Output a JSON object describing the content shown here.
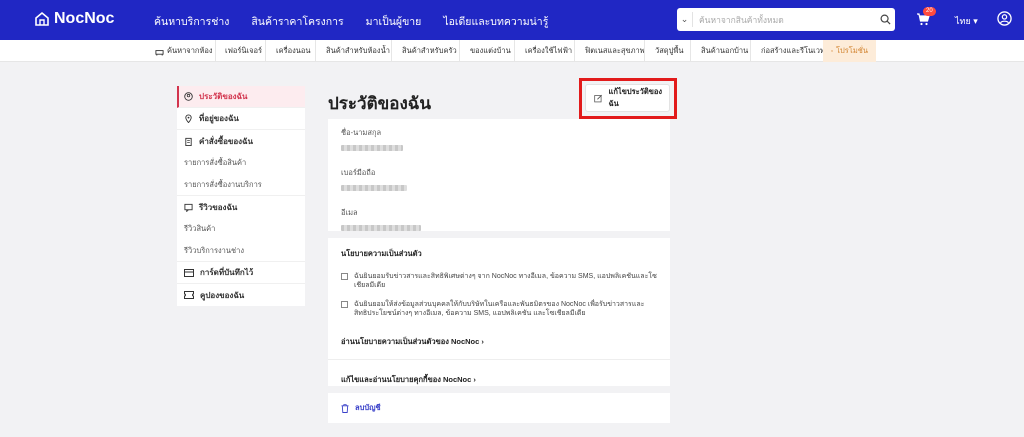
{
  "header": {
    "logo": "NocNoc",
    "nav": [
      "ค้นหาบริการช่าง",
      "สินค้าราคาโครงการ",
      "มาเป็นผู้ขาย",
      "ไอเดียและบทความน่ารู้"
    ],
    "search_placeholder": "ค้นหาจากสินค้าทั้งหมด",
    "cart_count": "20",
    "lang": "ไทย ▾"
  },
  "categories": [
    "ค้นหาจากห้อง",
    "เฟอร์นิเจอร์",
    "เครื่องนอน",
    "สินค้าสำหรับห้องน้ำ",
    "สินค้าสำหรับครัว",
    "ของแต่งบ้าน",
    "เครื่องใช้ไฟฟ้า",
    "ฟิตเนสและสุขภาพ",
    "วัสดุปูพื้น",
    "สินค้านอกบ้าน",
    "ก่อสร้างและรีโนเวท",
    "โปรโมชั่น"
  ],
  "sidebar": {
    "profile": "ประวัติของฉัน",
    "address": "ที่อยู่ของฉัน",
    "orders": "คำสั่งซื้อของฉัน",
    "order_products": "รายการสั่งซื้อสินค้า",
    "order_services": "รายการสั่งซื้องานบริการ",
    "reviews": "รีวิวของฉัน",
    "review_products": "รีวิวสินค้า",
    "review_services": "รีวิวบริการงานช่าง",
    "cards": "การ์ดที่บันทึกไว้",
    "coupons": "คูปองของฉัน"
  },
  "main": {
    "title": "ประวัติของฉัน",
    "edit_button": "แก้ไขประวัติของฉัน",
    "fields": {
      "name_label": "ชื่อ-นามสกุล",
      "phone_label": "เบอร์มือถือ",
      "email_label": "อีเมล"
    },
    "privacy": {
      "heading": "นโยบายความเป็นส่วนตัว",
      "consent1": "ฉันยินยอมรับข่าวสารและสิทธิพิเศษต่างๆ จาก NocNoc ทางอีเมล, ข้อความ SMS, แอปพลิเคชันและโซเชียลมีเดีย",
      "consent2": "ฉันยินยอมให้ส่งข้อมูลส่วนบุคคลให้กับบริษัทในเครือและพันธมิตรของ NocNoc เพื่อรับข่าวสารและสิทธิประโยชน์ต่างๆ ทางอีเมล, ข้อความ SMS, แอปพลิเคชัน และโซเชียลมีเดีย",
      "link1": "อ่านนโยบายความเป็นส่วนตัวของ NocNoc ›",
      "link2": "แก้ไขและอ่านนโยบายคุกกี้ของ NocNoc ›"
    },
    "delete_account": "ลบบัญชี"
  }
}
